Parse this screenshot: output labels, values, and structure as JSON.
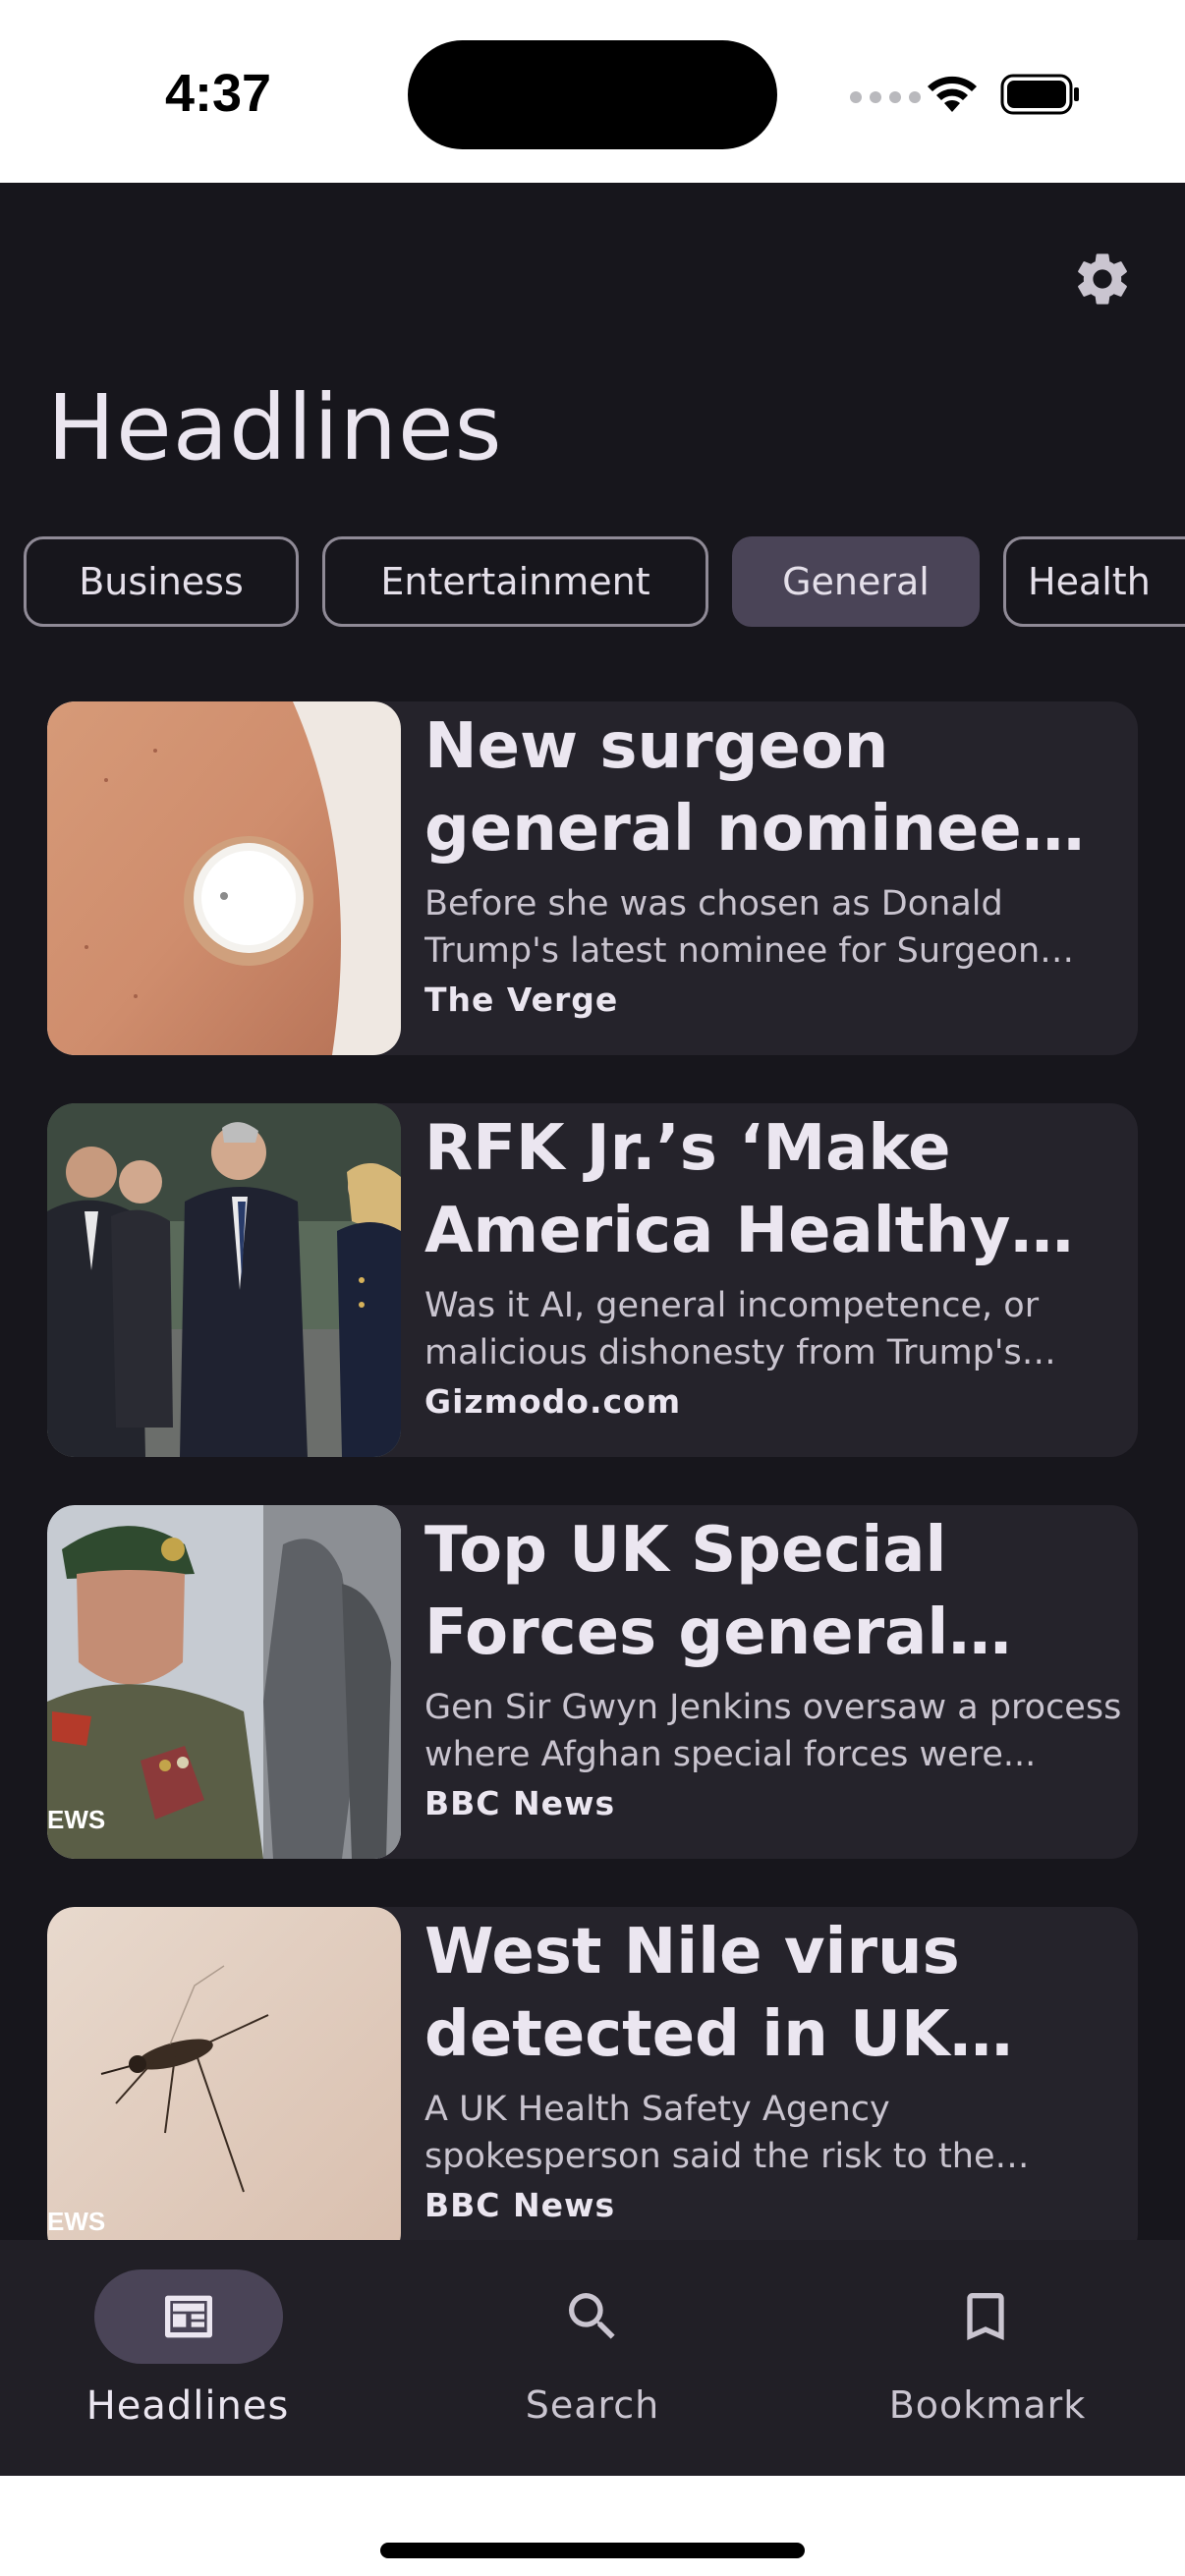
{
  "status_bar": {
    "time": "4:37"
  },
  "header": {
    "title": "Headlines"
  },
  "categories": [
    {
      "label": "Business",
      "selected": false
    },
    {
      "label": "Entertainment",
      "selected": false
    },
    {
      "label": "General",
      "selected": true
    },
    {
      "label": "Health",
      "selected": false
    }
  ],
  "articles": [
    {
      "headline": "New surgeon general nominee cofounded a company that makes glucose monitors",
      "description": "Before she was chosen as Donald Trump's latest nominee for Surgeon General, Casey Means...",
      "source": "The Verge",
      "image": "arm-with-glucose-monitor"
    },
    {
      "headline": "RFK Jr.’s ‘Make America Healthy Again’ report",
      "description": "Was it AI, general incompetence, or malicious dishonesty from Trump's friends...",
      "source": "Gizmodo.com",
      "image": "group-in-suits-walking"
    },
    {
      "headline": "Top UK Special Forces general oversaw process",
      "description": "Gen Sir Gwyn Jenkins oversaw a process where Afghan special forces were...",
      "source": "BBC News",
      "image": "general-in-beret",
      "watermark": "EWS"
    },
    {
      "headline": "West Nile virus detected in UK mosquitoes",
      "description": "A UK Health Safety Agency spokesperson said the risk to the general public...",
      "source": "BBC News",
      "image": "mosquito-on-skin",
      "watermark": "EWS"
    }
  ],
  "bottom_nav": [
    {
      "label": "Headlines",
      "icon": "newspaper-icon",
      "active": true
    },
    {
      "label": "Search",
      "icon": "search-icon",
      "active": false
    },
    {
      "label": "Bookmark",
      "icon": "bookmark-icon",
      "active": false
    }
  ],
  "colors": {
    "background": "#17161c",
    "card": "#25232b",
    "accent_container": "#4a4457",
    "text_primary": "#ebe6f0",
    "text_secondary": "#c9c4cf"
  }
}
